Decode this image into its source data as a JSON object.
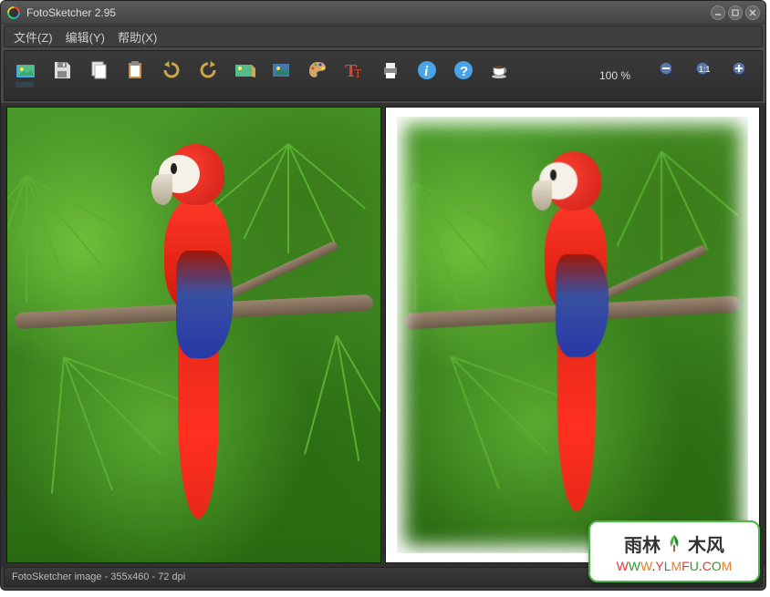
{
  "window": {
    "title": "FotoSketcher 2.95"
  },
  "menu": {
    "file": "文件(Z)",
    "edit": "编辑(Y)",
    "help": "帮助(X)"
  },
  "toolbar": {
    "icons": {
      "open": "open-image-icon",
      "save": "save-icon",
      "copy": "copy-icon",
      "paste": "paste-icon",
      "undo": "undo-icon",
      "redo": "redo-icon",
      "effects": "effects-icon",
      "source": "source-image-icon",
      "palette": "palette-icon",
      "text": "text-tool-icon",
      "print": "print-icon",
      "info": "info-icon",
      "help": "help-icon",
      "donate": "coffee-icon"
    },
    "zoom_label": "100 %",
    "zoom_out": "zoom-out-icon",
    "zoom_fit": "zoom-fit-icon",
    "zoom_in": "zoom-in-icon"
  },
  "status": {
    "text": "FotoSketcher image - 355x460 - 72 dpi"
  },
  "watermark": {
    "brand_left": "雨林",
    "brand_right": "木风",
    "url_parts": [
      "W",
      "W",
      "W",
      ".",
      "Y",
      "L",
      "M",
      "F",
      "U",
      ".",
      "C",
      "O",
      "M"
    ]
  },
  "image": {
    "subject": "scarlet-macaw-parrot",
    "environment": "tropical-palm-foliage",
    "left_panel": "original",
    "right_panel": "watercolor-sketch"
  }
}
